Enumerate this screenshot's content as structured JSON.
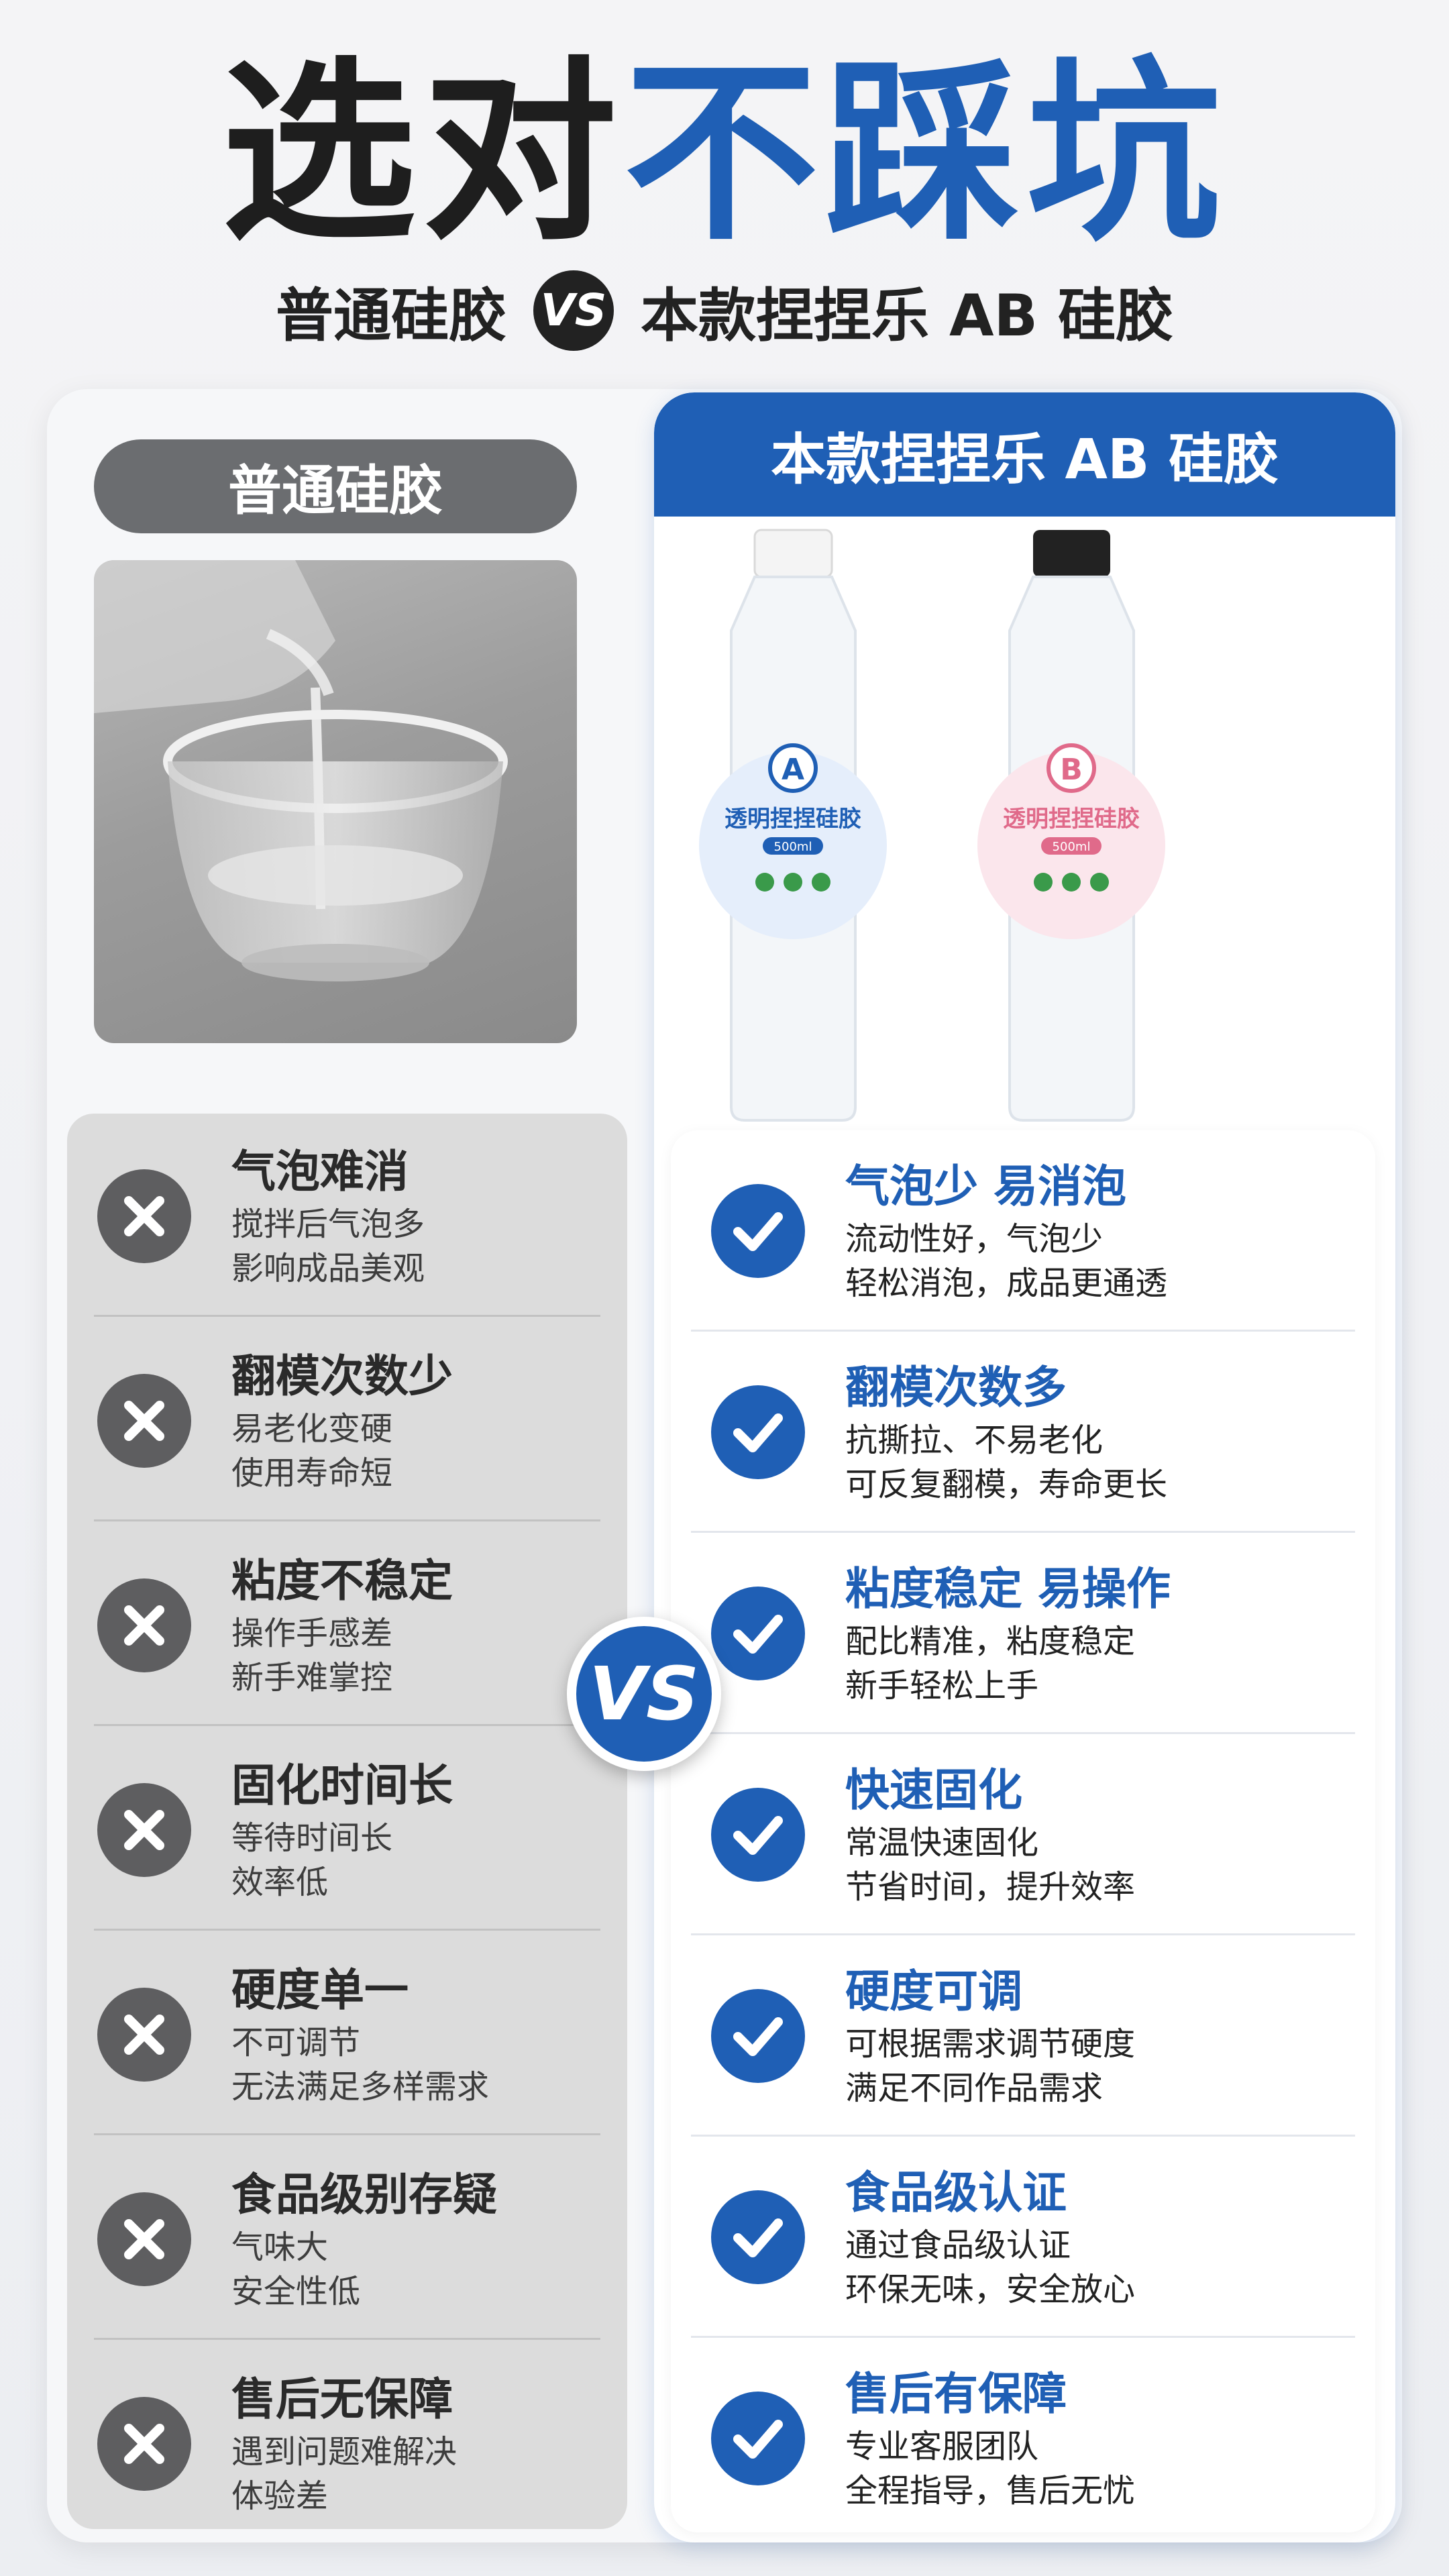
{
  "headline": {
    "part1": "选对",
    "part2": "不踩坑"
  },
  "subline": {
    "left": "普通硅胶",
    "vs": "VS",
    "right": "本款捏捏乐 AB 硅胶"
  },
  "left": {
    "title": "普通硅胶",
    "items": [
      {
        "title": "气泡难消",
        "line1": "搅拌后气泡多",
        "line2": "影响成品美观"
      },
      {
        "title": "翻模次数少",
        "line1": "易老化变硬",
        "line2": "使用寿命短"
      },
      {
        "title": "粘度不稳定",
        "line1": "操作手感差",
        "line2": "新手难掌控"
      },
      {
        "title": "固化时间长",
        "line1": "等待时间长",
        "line2": "效率低"
      },
      {
        "title": "硬度单一",
        "line1": "不可调节",
        "line2": "无法满足多样需求"
      },
      {
        "title": "食品级别存疑",
        "line1": "气味大",
        "line2": "安全性低"
      },
      {
        "title": "售后无保障",
        "line1": "遇到问题难解决",
        "line2": "体验差"
      }
    ]
  },
  "right": {
    "title": "本款捏捏乐 AB 硅胶",
    "bottle_a": {
      "letter": "A",
      "name": "透明捏捏硅胶",
      "volume": "500ml"
    },
    "bottle_b": {
      "letter": "B",
      "name": "透明捏捏硅胶",
      "volume": "500ml"
    },
    "items": [
      {
        "title": "气泡少 易消泡",
        "line1": "流动性好，气泡少",
        "line2": "轻松消泡，成品更通透"
      },
      {
        "title": "翻模次数多",
        "line1": "抗撕拉、不易老化",
        "line2": "可反复翻模，寿命更长"
      },
      {
        "title": "粘度稳定 易操作",
        "line1": "配比精准，粘度稳定",
        "line2": "新手轻松上手"
      },
      {
        "title": "快速固化",
        "line1": "常温快速固化",
        "line2": "节省时间，提升效率"
      },
      {
        "title": "硬度可调",
        "line1": "可根据需求调节硬度",
        "line2": "满足不同作品需求"
      },
      {
        "title": "食品级认证",
        "line1": "通过食品级认证",
        "line2": "环保无味，安全放心"
      },
      {
        "title": "售后有保障",
        "line1": "专业客服团队",
        "line2": "全程指导，售后无忧"
      }
    ]
  },
  "vs_badge": "VS",
  "colors": {
    "brand_blue": "#1f5fb5",
    "dark_gray": "#5e5e60",
    "left_bg": "#dcdcdc"
  },
  "icons": {
    "negative": "cross-icon",
    "positive": "check-icon"
  }
}
